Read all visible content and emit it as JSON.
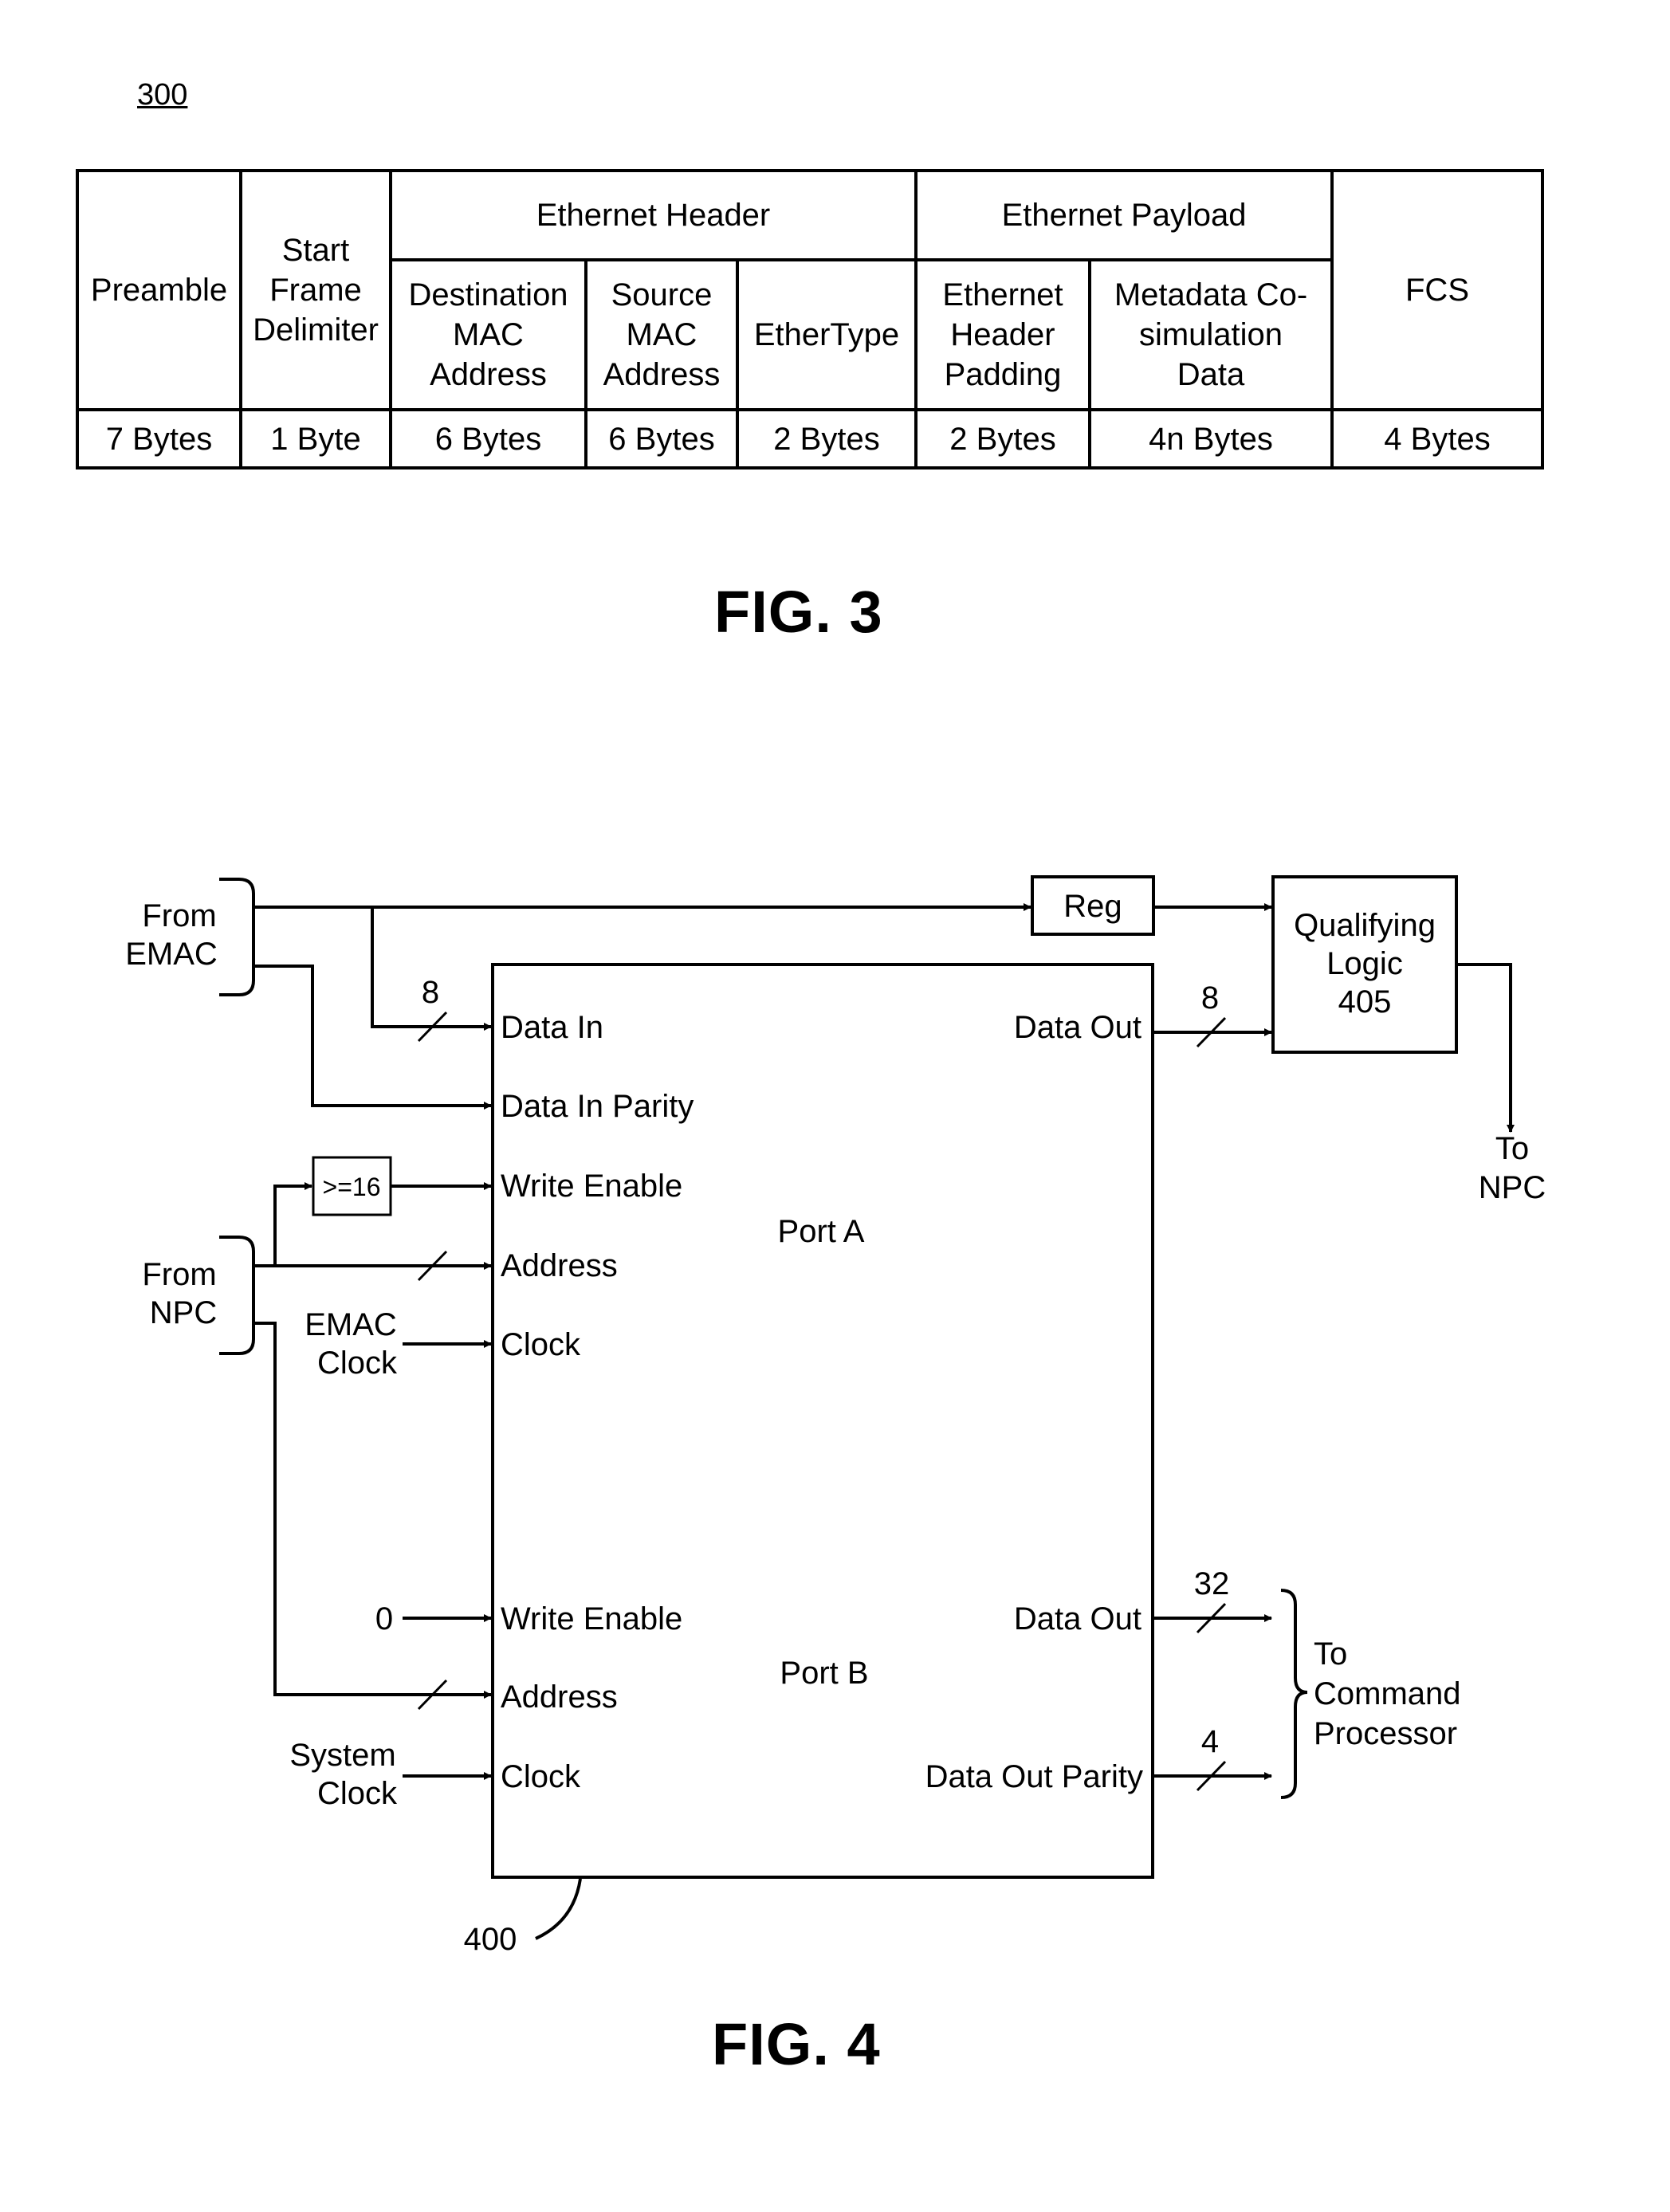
{
  "fig3": {
    "ref": "300",
    "caption": "FIG. 3",
    "top_groups": {
      "ethernet_header": "Ethernet Header",
      "ethernet_payload": "Ethernet Payload"
    },
    "fields": [
      {
        "name": "Preamble",
        "size": "7 Bytes"
      },
      {
        "name": "Start Frame Delimiter",
        "lines": [
          "Start",
          "Frame",
          "Delimiter"
        ],
        "size": "1 Byte"
      },
      {
        "name": "Destination MAC Address",
        "lines": [
          "Destination",
          "MAC",
          "Address"
        ],
        "size": "6 Bytes"
      },
      {
        "name": "Source MAC Address",
        "lines": [
          "Source",
          "MAC",
          "Address"
        ],
        "size": "6 Bytes"
      },
      {
        "name": "EtherType",
        "size": "2 Bytes"
      },
      {
        "name": "Ethernet Header Padding",
        "lines": [
          "Ethernet",
          "Header",
          "Padding"
        ],
        "size": "2 Bytes"
      },
      {
        "name": "Metadata Co-simulation Data",
        "lines": [
          "Metadata Co-",
          "simulation",
          "Data"
        ],
        "size": "4n Bytes"
      },
      {
        "name": "FCS",
        "size": "4 Bytes"
      }
    ]
  },
  "fig4": {
    "caption": "FIG. 4",
    "ref": "400",
    "sources": {
      "from_emac": [
        "From",
        "EMAC"
      ],
      "from_npc": [
        "From",
        "NPC"
      ],
      "emac_clock": [
        "EMAC",
        "Clock"
      ],
      "system_clock": [
        "System",
        "Clock"
      ],
      "zero": "0"
    },
    "blocks": {
      "reg": "Reg",
      "compare": ">=16",
      "qualifying_logic": [
        "Qualifying",
        "Logic",
        "405"
      ]
    },
    "port_a": {
      "label": "Port A",
      "inputs": [
        "Data In",
        "Data In Parity",
        "Write Enable",
        "Address",
        "Clock"
      ],
      "output": "Data Out"
    },
    "port_b": {
      "label": "Port B",
      "inputs": [
        "Write Enable",
        "Address",
        "Clock"
      ],
      "outputs": [
        "Data Out",
        "Data Out Parity"
      ]
    },
    "bus_widths": {
      "data_in": "8",
      "data_out_a": "8",
      "data_out_b": "32",
      "parity_out_b": "4"
    },
    "destinations": {
      "to_npc": [
        "To",
        "NPC"
      ],
      "to_command_processor": [
        "To",
        "Command",
        "Processor"
      ]
    }
  }
}
